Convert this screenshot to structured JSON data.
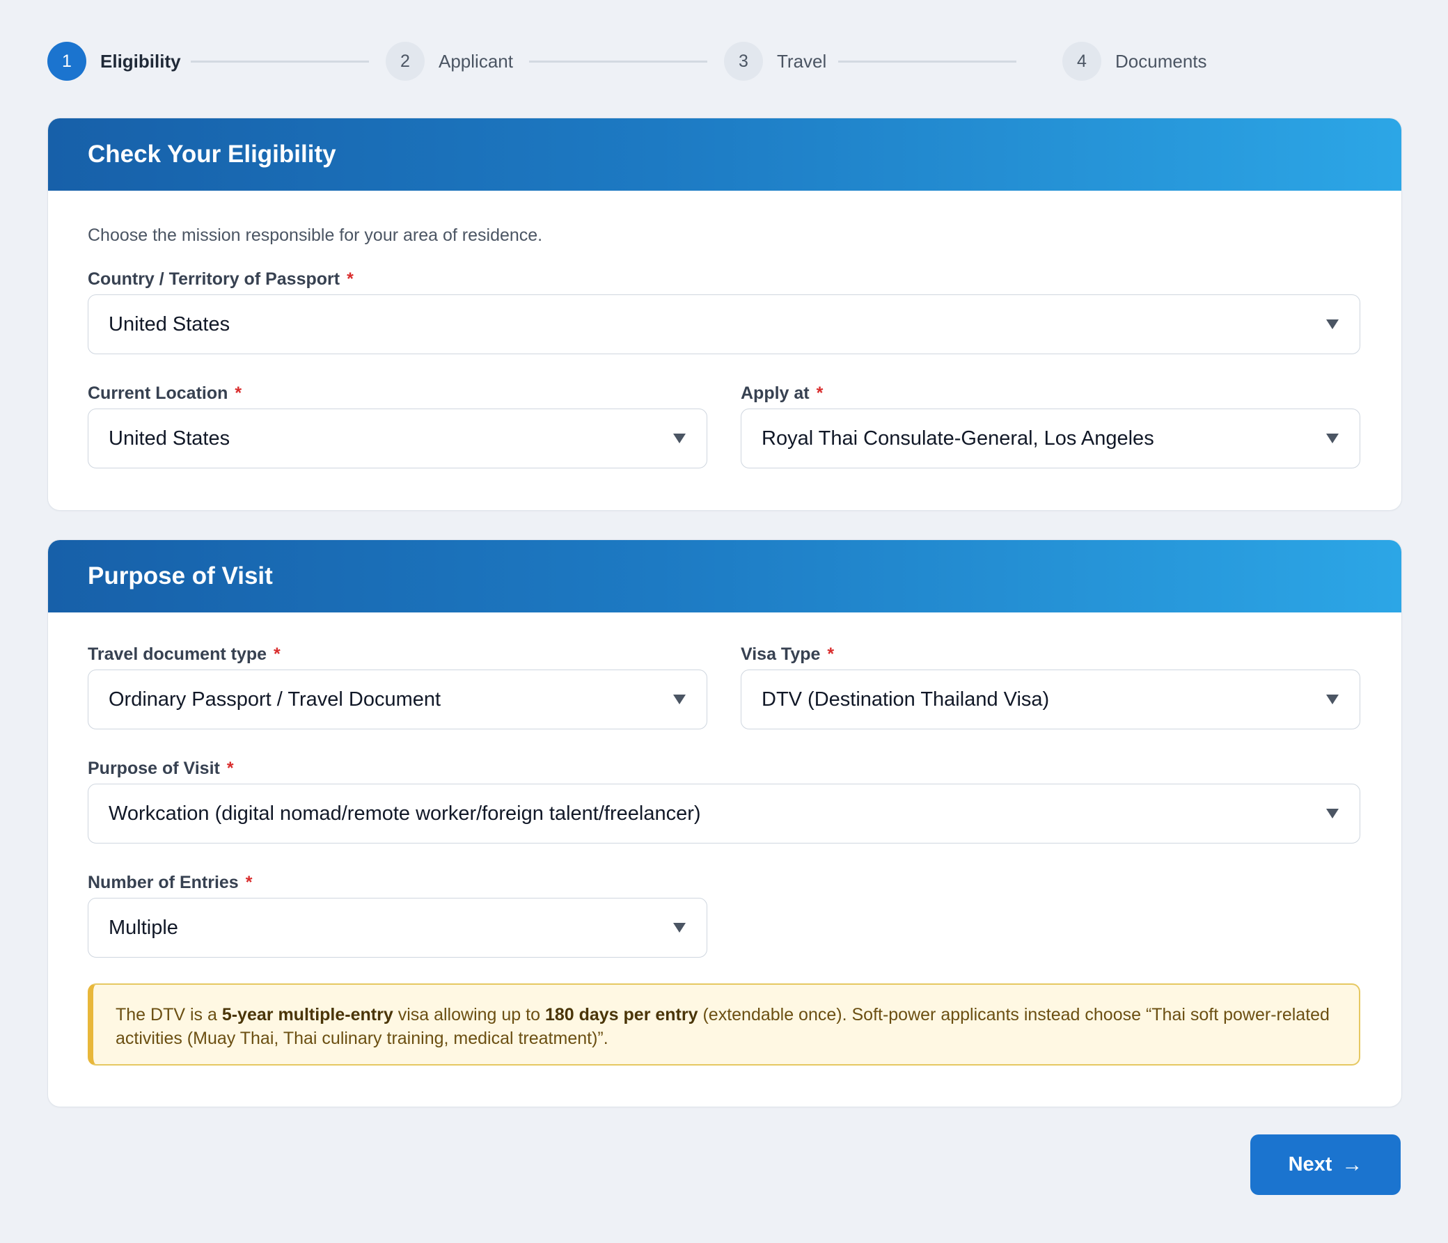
{
  "stepper": {
    "steps": [
      {
        "num": "1",
        "label": "Eligibility"
      },
      {
        "num": "2",
        "label": "Applicant"
      },
      {
        "num": "3",
        "label": "Travel"
      },
      {
        "num": "4",
        "label": "Documents"
      }
    ],
    "active_step": 1
  },
  "eligibility": {
    "title": "Check Your Eligibility",
    "help": "Choose the mission responsible for your area of residence.",
    "passport_country": {
      "label": "Country / Territory of Passport",
      "required_mark": "*",
      "value": "United States"
    },
    "current_location": {
      "label": "Current Location",
      "required_mark": "*",
      "value": "United States"
    },
    "apply_at": {
      "label": "Apply at",
      "required_mark": "*",
      "value": "Royal Thai Consulate-General, Los Angeles"
    }
  },
  "purpose": {
    "title": "Purpose of Visit",
    "travel_document_type": {
      "label": "Travel document type",
      "required_mark": "*",
      "value": "Ordinary Passport / Travel Document"
    },
    "visa_type": {
      "label": "Visa Type",
      "required_mark": "*",
      "value": "DTV (Destination Thailand Visa)"
    },
    "purpose_of_visit": {
      "label": "Purpose of Visit",
      "required_mark": "*",
      "value": "Workcation (digital nomad/remote worker/foreign talent/freelancer)"
    },
    "number_of_entries": {
      "label": "Number of Entries",
      "required_mark": "*",
      "value": "Multiple"
    },
    "note": {
      "t1": "The DTV is a ",
      "b1": "5-year multiple-entry",
      "t2": " visa allowing up to ",
      "b2": "180 days per entry",
      "t3": " (extendable once). Soft-power applicants instead choose “Thai soft power-related activities (Muay Thai, Thai culinary training, medical treatment)”."
    }
  },
  "actions": {
    "next_label": "Next",
    "next_arrow": "→"
  },
  "colors": {
    "accent": "#1b74cf",
    "required": "#d92d2d",
    "note_bg": "#fff8e3",
    "note_border": "#e8b73a"
  }
}
